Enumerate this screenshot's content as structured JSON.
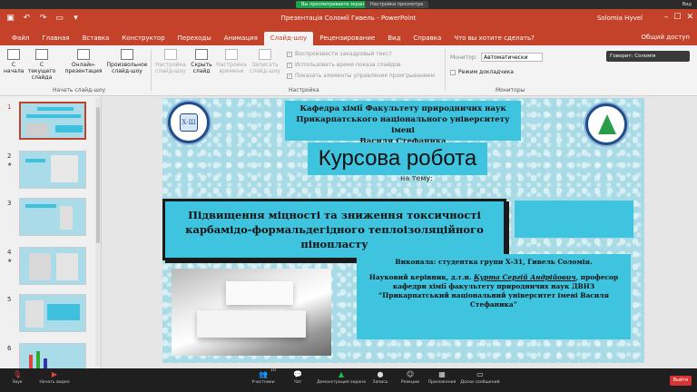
{
  "zoom_strip": {
    "viewing_label": "Вы просматриваете экран Solomia",
    "view_options": "Настройки просмотра",
    "exit_label": "Вид"
  },
  "titlebar": {
    "title": "Презентація Соломії Гивель - PowerPoint",
    "user": "Solomia Hyvel",
    "min_glyph": "–",
    "max_glyph": "☐",
    "close_glyph": "✕"
  },
  "tabs": [
    {
      "label": "Файл"
    },
    {
      "label": "Главная"
    },
    {
      "label": "Вставка"
    },
    {
      "label": "Конструктор"
    },
    {
      "label": "Переходы"
    },
    {
      "label": "Анимация"
    },
    {
      "label": "Слайд-шоу"
    },
    {
      "label": "Рецензирование"
    },
    {
      "label": "Вид"
    },
    {
      "label": "Справка"
    },
    {
      "label": "Что вы хотите сделать?"
    }
  ],
  "share_label": "Общий доступ",
  "ribbon": {
    "from_start": "С начала",
    "from_current": "С текущего слайда",
    "online": "Онлайн-презентация",
    "custom": "Произвольное слайд-шоу",
    "group_start": "Начать слайд-шоу",
    "setup": "Настройка слайд-шоу",
    "hide": "Скрыть слайд",
    "rehearse": "Настройка времени",
    "record": "Записать слайд-шоу",
    "chk_narration": "Воспроизвести закадровый текст",
    "chk_timing": "Использовать время показа слайдов",
    "chk_controls": "Показать элементы управления проигрыванием",
    "group_setup": "Настройка",
    "monitor_label": "Монитор:",
    "monitor_value": "Автоматически",
    "presenter_view": "Режим докладчика",
    "group_monitors": "Мониторы"
  },
  "speaker_label": "Говорит: Соломія",
  "thumbnails": [
    {
      "number": "1"
    },
    {
      "number": "2",
      "star": "★"
    },
    {
      "number": "3"
    },
    {
      "number": "4",
      "star": "★"
    },
    {
      "number": "5"
    },
    {
      "number": "6"
    }
  ],
  "slide": {
    "logo_left_text": "Х-Ш",
    "header_line1": "Кафедра хімії Факультету природничих наук",
    "header_line2": "Прикарпатського національного університету імені",
    "header_line3": "Василя Стефаника",
    "title": "Курсова робота",
    "subtitle": "на тему:",
    "topic_line1": "Підвищення міцності та зниження токсичності",
    "topic_line2": "карбамідо-формальдегідного теплоізоляційного",
    "topic_line3": "пінопласту",
    "performer": "Виконала: студентка групи Х-31, Гивель Соломія.",
    "supervisor_pre": "Науковий керівник, д.т.н.",
    "supervisor_name": "Курта Сергій Андрійович",
    "supervisor_post": ", професор",
    "dept_line": "кафедри хімії факультету природничих наук ДВНЗ",
    "univ_line1": "“Прикарпатський національний університет імені Василя",
    "univ_line2": "Стефаника”"
  },
  "zoombar": {
    "audio": "Звук",
    "video": "Начать видео",
    "participants": "Участники",
    "participants_count": "10",
    "chat": "Чат",
    "share": "Демонстрация экрана",
    "record": "Запись",
    "reactions": "Реакции",
    "apps": "Приложения",
    "whiteboard": "Доски сообщений",
    "leave": "Выйти"
  },
  "colors": {
    "accent": "#c4412a",
    "slide_box": "#3fc4e0",
    "slide_bg": "#a8dbe6",
    "zoom_green": "#1aa34a",
    "leave_red": "#d93434"
  }
}
